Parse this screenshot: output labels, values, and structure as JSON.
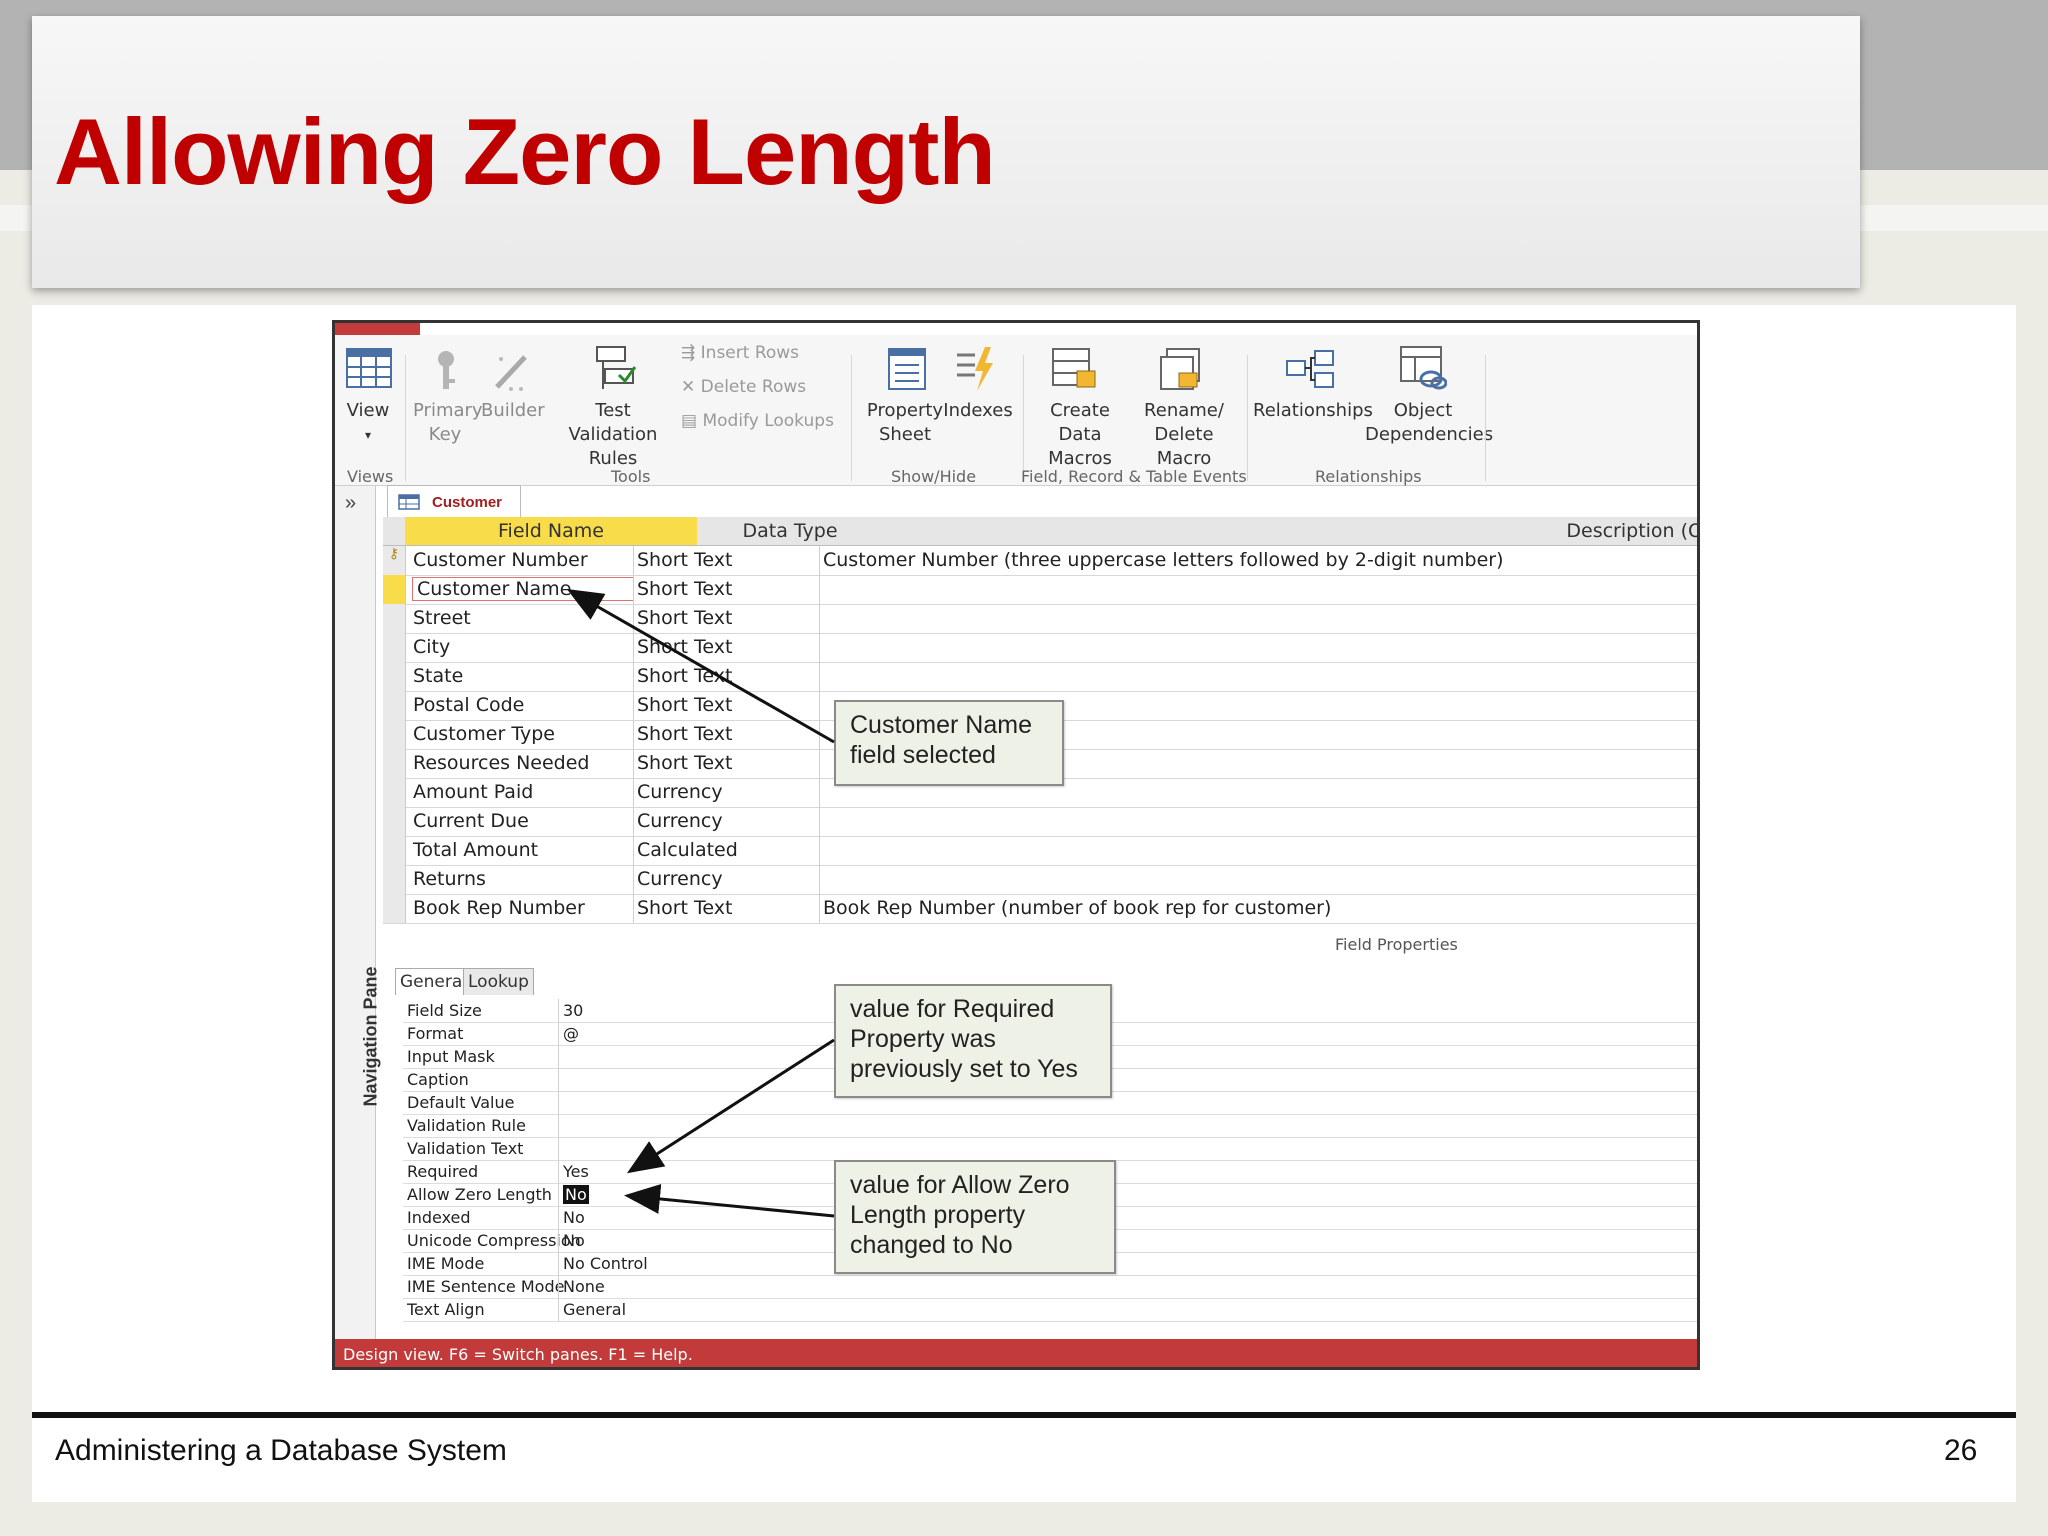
{
  "slide": {
    "title": "Allowing Zero Length",
    "footer": "Administering a Database System",
    "page_number": "26"
  },
  "ribbon": {
    "buttons": {
      "view": "View",
      "primary_key": "Primary Key",
      "builder": "Builder",
      "test_validation_rules": "Test Validation Rules",
      "insert_rows": "Insert Rows",
      "delete_rows": "Delete Rows",
      "modify_lookups": "Modify Lookups",
      "property_sheet": "Property Sheet",
      "indexes": "Indexes",
      "create_data_macros": "Create Data Macros",
      "rename_delete_macro": "Rename/ Delete Macro",
      "relationships": "Relationships",
      "object_dependencies": "Object Dependencies"
    },
    "groups": {
      "views": "Views",
      "tools": "Tools",
      "show_hide": "Show/Hide",
      "field_record_table_events": "Field, Record & Table Events",
      "relationships": "Relationships"
    }
  },
  "navigation": {
    "expand": "»",
    "label": "Navigation Pane"
  },
  "document_tab": "Customer",
  "grid": {
    "headers": {
      "field_name": "Field Name",
      "data_type": "Data Type",
      "description": "Description (O"
    },
    "rows": [
      {
        "name": "Customer Number",
        "type": "Short Text",
        "desc": "Customer Number (three uppercase letters followed by 2-digit number)"
      },
      {
        "name": "Customer Name",
        "type": "Short Text",
        "desc": ""
      },
      {
        "name": "Street",
        "type": "Short Text",
        "desc": ""
      },
      {
        "name": "City",
        "type": "Short Text",
        "desc": ""
      },
      {
        "name": "State",
        "type": "Short Text",
        "desc": ""
      },
      {
        "name": "Postal Code",
        "type": "Short Text",
        "desc": ""
      },
      {
        "name": "Customer Type",
        "type": "Short Text",
        "desc": ""
      },
      {
        "name": "Resources Needed",
        "type": "Short Text",
        "desc": ""
      },
      {
        "name": "Amount Paid",
        "type": "Currency",
        "desc": ""
      },
      {
        "name": "Current Due",
        "type": "Currency",
        "desc": ""
      },
      {
        "name": "Total Amount",
        "type": "Calculated",
        "desc": ""
      },
      {
        "name": "Returns",
        "type": "Currency",
        "desc": ""
      },
      {
        "name": "Book Rep Number",
        "type": "Short Text",
        "desc": "Book Rep Number (number of book rep for customer)"
      }
    ]
  },
  "field_properties": {
    "label": "Field Properties",
    "tabs": {
      "general": "General",
      "lookup": "Lookup"
    },
    "rows": [
      {
        "name": "Field Size",
        "value": "30"
      },
      {
        "name": "Format",
        "value": "@"
      },
      {
        "name": "Input Mask",
        "value": ""
      },
      {
        "name": "Caption",
        "value": ""
      },
      {
        "name": "Default Value",
        "value": ""
      },
      {
        "name": "Validation Rule",
        "value": ""
      },
      {
        "name": "Validation Text",
        "value": ""
      },
      {
        "name": "Required",
        "value": "Yes"
      },
      {
        "name": "Allow Zero Length",
        "value": "No"
      },
      {
        "name": "Indexed",
        "value": "No"
      },
      {
        "name": "Unicode Compression",
        "value": "No"
      },
      {
        "name": "IME Mode",
        "value": "No Control"
      },
      {
        "name": "IME Sentence Mode",
        "value": "None"
      },
      {
        "name": "Text Align",
        "value": "General"
      }
    ]
  },
  "status_bar": "Design view.  F6 = Switch panes.  F1 = Help.",
  "callouts": {
    "customer_name": "Customer Name field selected",
    "required": "value for Required Property was previously set to Yes",
    "allow_zero": "value for Allow Zero Length property changed to No"
  },
  "colors": {
    "title_red": "#c00000",
    "access_red": "#c23a3a",
    "header_highlight": "#f8dc4a",
    "callout_bg": "#eef2e6"
  }
}
